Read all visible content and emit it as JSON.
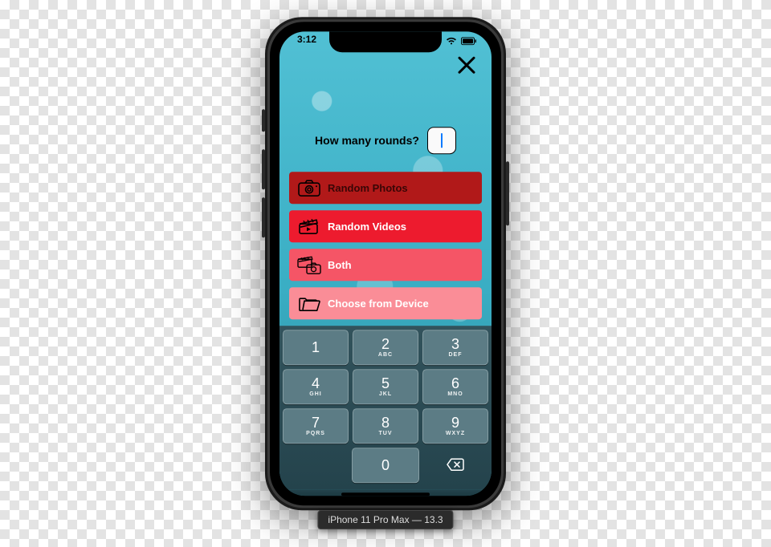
{
  "statusbar": {
    "time": "3:12"
  },
  "close_icon_name": "close-icon",
  "prompt": {
    "label": "How many rounds?",
    "value": ""
  },
  "options": {
    "photos": {
      "label": "Random Photos",
      "icon": "camera-icon"
    },
    "videos": {
      "label": "Random Videos",
      "icon": "clapper-icon"
    },
    "both": {
      "label": "Both",
      "icon": "camera-clapper-icon"
    },
    "device": {
      "label": "Choose from Device",
      "icon": "folder-icon"
    }
  },
  "keypad": {
    "rows": [
      [
        {
          "n": "1",
          "s": ""
        },
        {
          "n": "2",
          "s": "ABC"
        },
        {
          "n": "3",
          "s": "DEF"
        }
      ],
      [
        {
          "n": "4",
          "s": "GHI"
        },
        {
          "n": "5",
          "s": "JKL"
        },
        {
          "n": "6",
          "s": "MNO"
        }
      ],
      [
        {
          "n": "7",
          "s": "PQRS"
        },
        {
          "n": "8",
          "s": "TUV"
        },
        {
          "n": "9",
          "s": "WXYZ"
        }
      ]
    ],
    "zero": {
      "n": "0",
      "s": ""
    }
  },
  "device_caption": "iPhone 11 Pro Max — 13.3"
}
